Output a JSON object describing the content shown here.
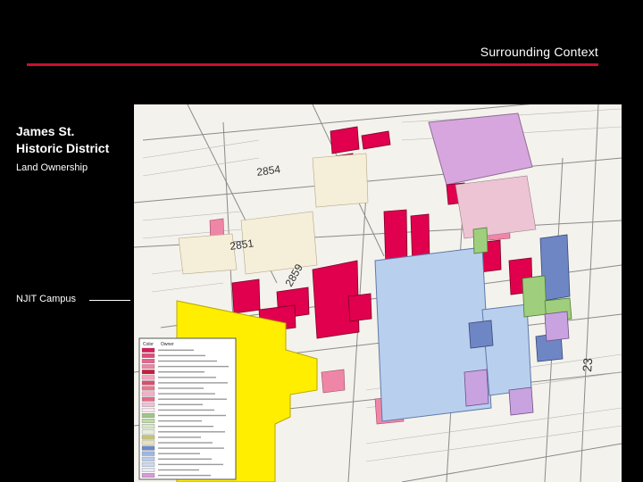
{
  "header": {
    "title": "Surrounding Context"
  },
  "sidebar": {
    "title_line1": "James St.",
    "title_line2": "Historic District",
    "subtitle": "Land Ownership",
    "pointer_label": "NJIT Campus"
  },
  "map": {
    "block_numbers": [
      "2854",
      "2851",
      "2859",
      "23"
    ],
    "legend_title": "Color",
    "legend_header": "Owner",
    "legend_items": [
      {
        "color": "#d81c5a",
        "label": ""
      },
      {
        "color": "#e04b7a",
        "label": ""
      },
      {
        "color": "#e86490",
        "label": ""
      },
      {
        "color": "#ef86a8",
        "label": ""
      },
      {
        "color": "#c71e3a",
        "label": ""
      },
      {
        "color": "#f3a6bd",
        "label": ""
      },
      {
        "color": "#d84f6f",
        "label": ""
      },
      {
        "color": "#e9758f",
        "label": ""
      },
      {
        "color": "#f1b0c6",
        "label": ""
      },
      {
        "color": "#e56a8c",
        "label": ""
      },
      {
        "color": "#ecc4d4",
        "label": ""
      },
      {
        "color": "#f7e8ee",
        "label": ""
      },
      {
        "color": "#9ec784",
        "label": ""
      },
      {
        "color": "#c2d9a8",
        "label": ""
      },
      {
        "color": "#d8e7c6",
        "label": ""
      },
      {
        "color": "#e6eedb",
        "label": ""
      },
      {
        "color": "#c4c27a",
        "label": ""
      },
      {
        "color": "#e7e2b8",
        "label": ""
      },
      {
        "color": "#6b8cc8",
        "label": ""
      },
      {
        "color": "#9db8e0",
        "label": ""
      },
      {
        "color": "#b8cdea",
        "label": ""
      },
      {
        "color": "#cdd9ee",
        "label": ""
      },
      {
        "color": "#e5eaf4",
        "label": ""
      },
      {
        "color": "#d99ad6",
        "label": ""
      }
    ],
    "colors": {
      "njit_campus": "#ffee00",
      "private_owner": "#e0004d",
      "university": "#b9cfee",
      "gov_blue": "#6f86c4",
      "green": "#9fcf7c",
      "purple": "#d8a6df",
      "lavender": "#e2c7ee"
    }
  }
}
